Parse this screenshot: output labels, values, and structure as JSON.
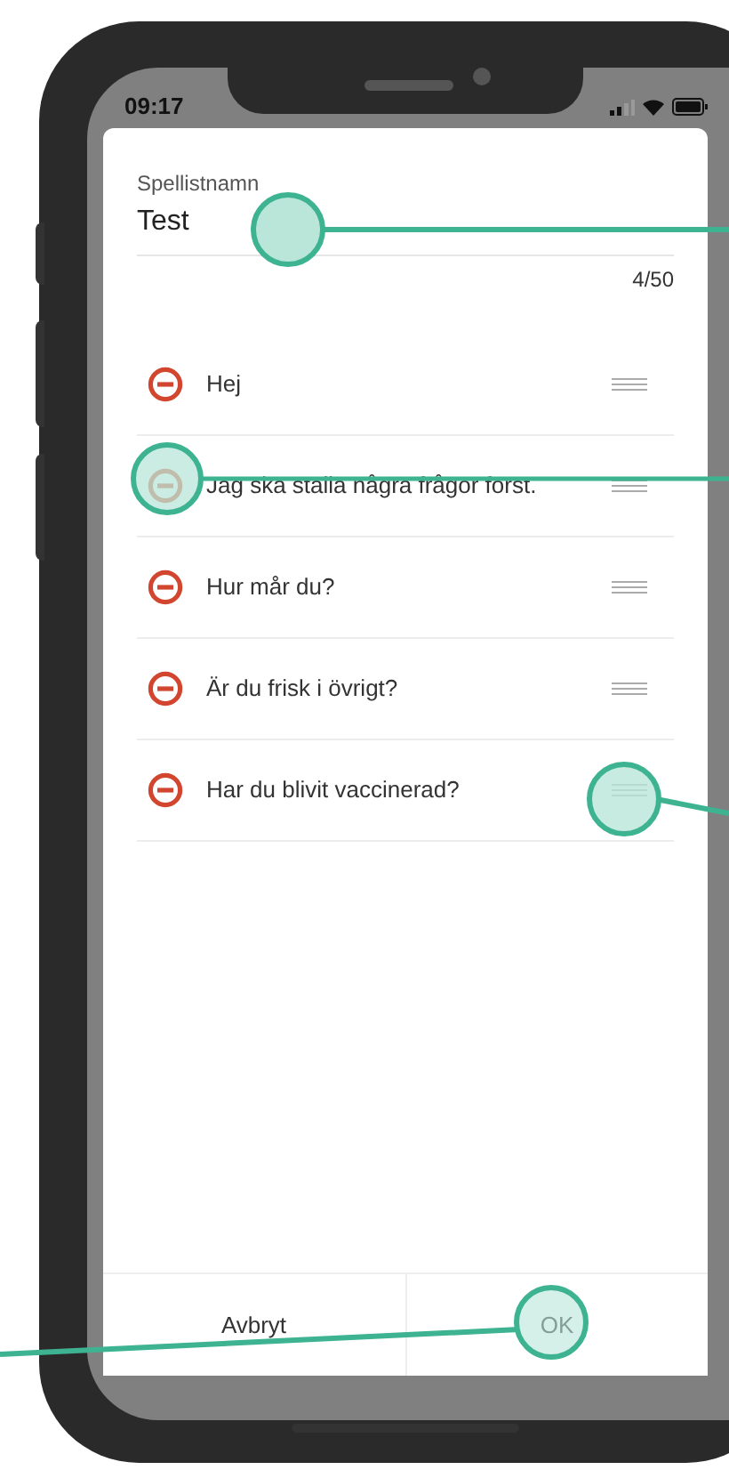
{
  "status_bar": {
    "time": "09:17"
  },
  "playlist_name": {
    "label": "Spellistnamn",
    "value": "Test",
    "counter": "4/50"
  },
  "items": [
    {
      "text": "Hej"
    },
    {
      "text": "Jag ska ställa några frågor först."
    },
    {
      "text": "Hur mår du?"
    },
    {
      "text": "Är du frisk i övrigt?"
    },
    {
      "text": "Har du blivit vaccinerad?"
    }
  ],
  "buttons": [
    {
      "label": "Avbryt"
    },
    {
      "label": "OK"
    }
  ]
}
